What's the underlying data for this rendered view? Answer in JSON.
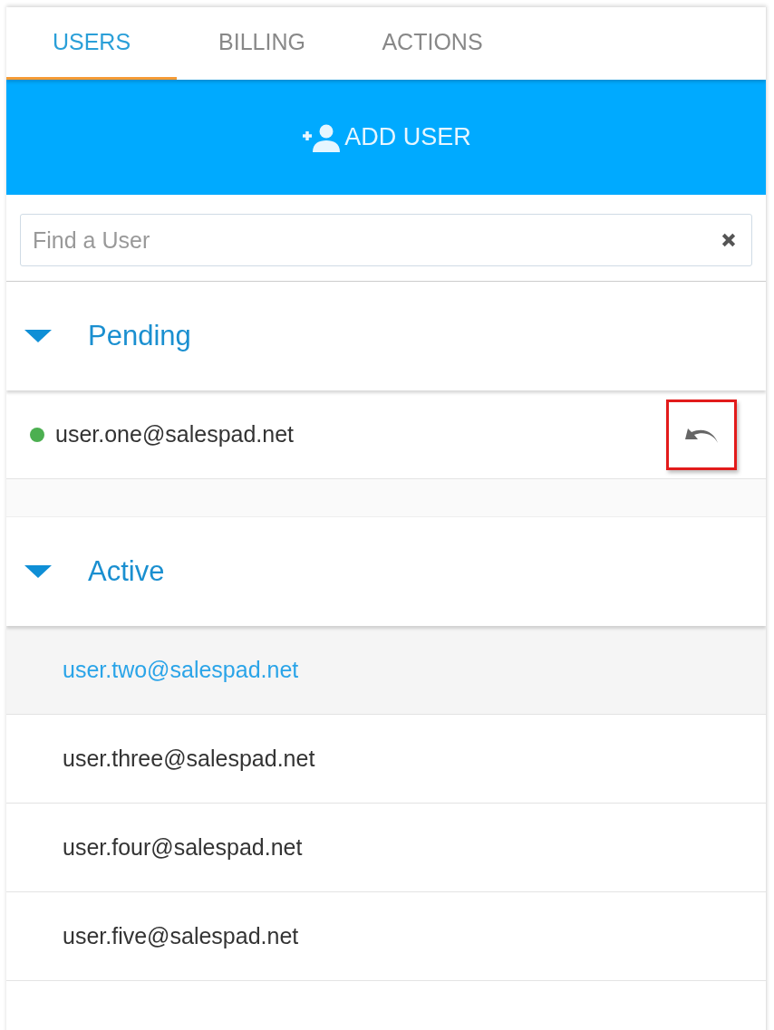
{
  "tabs": [
    {
      "label": "USERS",
      "selected": true
    },
    {
      "label": "BILLING",
      "selected": false
    },
    {
      "label": "ACTIONS",
      "selected": false
    }
  ],
  "add_button": {
    "label": "ADD USER"
  },
  "search": {
    "placeholder": "Find a User"
  },
  "sections": [
    {
      "title": "Pending",
      "expanded": true,
      "users": [
        {
          "email": "user.one@salespad.net",
          "color": "#4caf50",
          "selected": false,
          "action": {
            "kind": "undo",
            "highlighted": true
          }
        }
      ]
    },
    {
      "title": "Active",
      "expanded": true,
      "users": [
        {
          "email": "user.two@salespad.net",
          "selected": true
        },
        {
          "email": "user.three@salespad.net",
          "selected": false
        },
        {
          "email": "user.four@salespad.net",
          "selected": false
        },
        {
          "email": "user.five@salespad.net",
          "selected": false
        }
      ]
    }
  ]
}
